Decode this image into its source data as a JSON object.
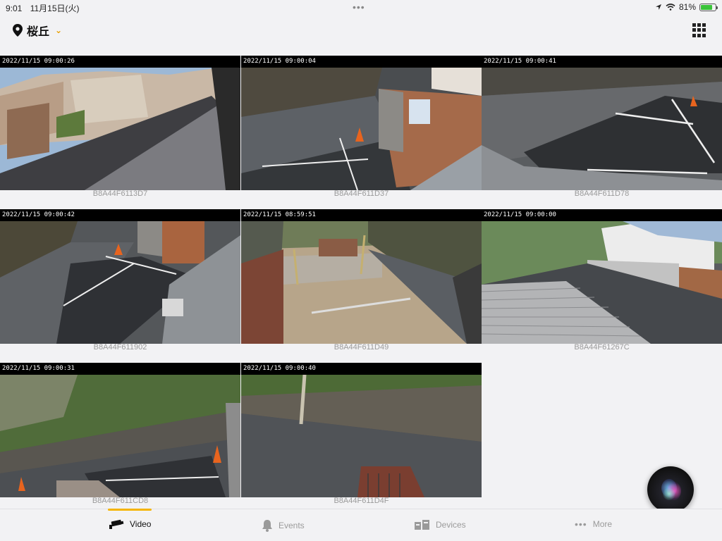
{
  "status": {
    "time": "9:01",
    "date": "11月15日(火)",
    "dots": "•••",
    "battery_text": "81%",
    "battery_level": 0.81
  },
  "header": {
    "location": "桜丘"
  },
  "cameras": [
    {
      "timestamp": "2022/11/15 09:00:26",
      "id": "B8A44F6113D7"
    },
    {
      "timestamp": "2022/11/15 09:00:04",
      "id": "B8A44F611D37"
    },
    {
      "timestamp": "2022/11/15 09:00:41",
      "id": "B8A44F611D78"
    },
    {
      "timestamp": "2022/11/15 09:00:42",
      "id": "B8A44F611902"
    },
    {
      "timestamp": "2022/11/15 08:59:51",
      "id": "B8A44F611D49"
    },
    {
      "timestamp": "2022/11/15 09:00:00",
      "id": "B8A44F61267C"
    },
    {
      "timestamp": "2022/11/15 09:00:31",
      "id": "B8A44F611CD8"
    },
    {
      "timestamp": "2022/11/15 09:00:40",
      "id": "B8A44F611D4F"
    }
  ],
  "tabs": [
    {
      "label": "Video",
      "icon": "camera-icon",
      "active": true
    },
    {
      "label": "Events",
      "icon": "bell-icon",
      "active": false
    },
    {
      "label": "Devices",
      "icon": "devices-icon",
      "active": false
    },
    {
      "label": "More",
      "icon": "more-dots-icon",
      "active": false
    }
  ],
  "colors": {
    "accent": "#f5b400",
    "battery": "#3ac33a"
  }
}
